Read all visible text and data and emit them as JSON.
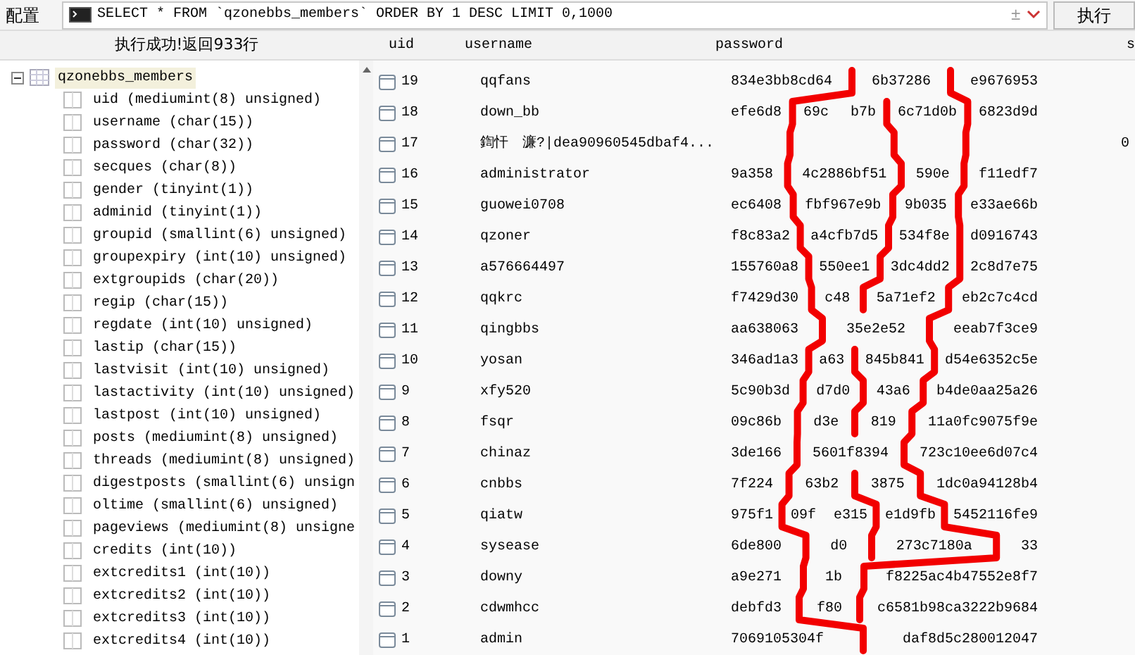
{
  "toolbar": {
    "config_label": "配置",
    "query": "SELECT * FROM `qzonebbs_members` ORDER BY 1 DESC LIMIT 0,1000",
    "plus_minus": "±",
    "execute_button": "执行"
  },
  "status": "执行成功!返回933行",
  "tree": {
    "label": "qzonebbs_members",
    "expanded": true,
    "selected": true,
    "children": [
      {
        "label": "uid (mediumint(8) unsigned)"
      },
      {
        "label": "username (char(15))"
      },
      {
        "label": "password (char(32))"
      },
      {
        "label": "secques (char(8))"
      },
      {
        "label": "gender (tinyint(1))"
      },
      {
        "label": "adminid (tinyint(1))"
      },
      {
        "label": "groupid (smallint(6) unsigned)"
      },
      {
        "label": "groupexpiry (int(10) unsigned)"
      },
      {
        "label": "extgroupids (char(20))"
      },
      {
        "label": "regip (char(15))"
      },
      {
        "label": "regdate (int(10) unsigned)"
      },
      {
        "label": "lastip (char(15))"
      },
      {
        "label": "lastvisit (int(10) unsigned)"
      },
      {
        "label": "lastactivity (int(10) unsigned)"
      },
      {
        "label": "lastpost (int(10) unsigned)"
      },
      {
        "label": "posts (mediumint(8) unsigned)"
      },
      {
        "label": "threads (mediumint(8) unsigned)"
      },
      {
        "label": "digestposts (smallint(6) unsign"
      },
      {
        "label": "oltime (smallint(6) unsigned)"
      },
      {
        "label": "pageviews (mediumint(8) unsigne"
      },
      {
        "label": "credits (int(10))"
      },
      {
        "label": "extcredits1 (int(10))"
      },
      {
        "label": "extcredits2 (int(10))"
      },
      {
        "label": "extcredits3 (int(10))"
      },
      {
        "label": "extcredits4 (int(10))"
      }
    ]
  },
  "results": {
    "columns": [
      "uid",
      "username",
      "password",
      "s"
    ],
    "rows": [
      {
        "uid": "19",
        "username": "qqfans",
        "password_parts": [
          "834e3bb8cd64",
          "6b37286",
          "e9676953"
        ]
      },
      {
        "uid": "18",
        "username": "down_bb",
        "password_parts": [
          "efe6d8",
          "69c",
          "b7b",
          "6c71d0b",
          "6823d9d"
        ]
      },
      {
        "uid": "17",
        "username": "鍧忓　濂?|dea90960545dbaf4...",
        "column_4": "0"
      },
      {
        "uid": "16",
        "username": "administrator",
        "password_parts": [
          "9a358",
          "4c2886bf51",
          "590e",
          "f11edf7"
        ]
      },
      {
        "uid": "15",
        "username": "guowei0708",
        "password_parts": [
          "ec6408",
          "fbf967e9b",
          "9b035",
          "e33ae66b"
        ]
      },
      {
        "uid": "14",
        "username": "qzoner",
        "password_parts": [
          "f8c83a2",
          "a4cfb7d5",
          "534f8e",
          "d0916743"
        ]
      },
      {
        "uid": "13",
        "username": "a576664497",
        "password_parts": [
          "155760a8",
          "550ee1",
          "3dc4dd2",
          "2c8d7e75"
        ]
      },
      {
        "uid": "12",
        "username": "qqkrc",
        "password_parts": [
          "f7429d30",
          "c48",
          "5a71ef2",
          "eb2c7c4cd"
        ]
      },
      {
        "uid": "11",
        "username": "qingbbs",
        "password_parts": [
          "aa638063",
          "35e2e52",
          "eeab7f3ce9"
        ]
      },
      {
        "uid": "10",
        "username": "yosan",
        "password_parts": [
          "346ad1a3",
          "a63",
          "845b841",
          "d54e6352c5e"
        ]
      },
      {
        "uid": "9",
        "username": "xfy520",
        "password_parts": [
          "5c90b3d",
          "d7d0",
          "43a6",
          "b4de0aa25a26"
        ]
      },
      {
        "uid": "8",
        "username": "fsqr",
        "password_parts": [
          "09c86b",
          "d3e",
          "819",
          "11a0fc9075f9e"
        ]
      },
      {
        "uid": "7",
        "username": "chinaz",
        "password_parts": [
          "3de166",
          "5601f8394",
          "723c10ee6d07c4"
        ]
      },
      {
        "uid": "6",
        "username": "cnbbs",
        "password_parts": [
          "7f224",
          "63b2",
          "3875",
          "1dc0a94128b4"
        ]
      },
      {
        "uid": "5",
        "username": "qiatw",
        "password_parts": [
          "975f1",
          "09f",
          "e315",
          "e1d9fb",
          "5452116fe9"
        ]
      },
      {
        "uid": "4",
        "username": "sysease",
        "password_parts": [
          "6de800",
          "d0",
          "273c7180a",
          "33"
        ]
      },
      {
        "uid": "3",
        "username": "downy",
        "password_parts": [
          "a9e271",
          "1b",
          "f8225ac4b47552e8f7"
        ]
      },
      {
        "uid": "2",
        "username": "cdwmhcc",
        "password_parts": [
          "debfd3",
          "f80",
          "c6581b98ca3222b9684"
        ]
      },
      {
        "uid": "1",
        "username": "admin",
        "password_parts": [
          "7069105304f",
          "daf8d5c280012047"
        ]
      }
    ]
  }
}
